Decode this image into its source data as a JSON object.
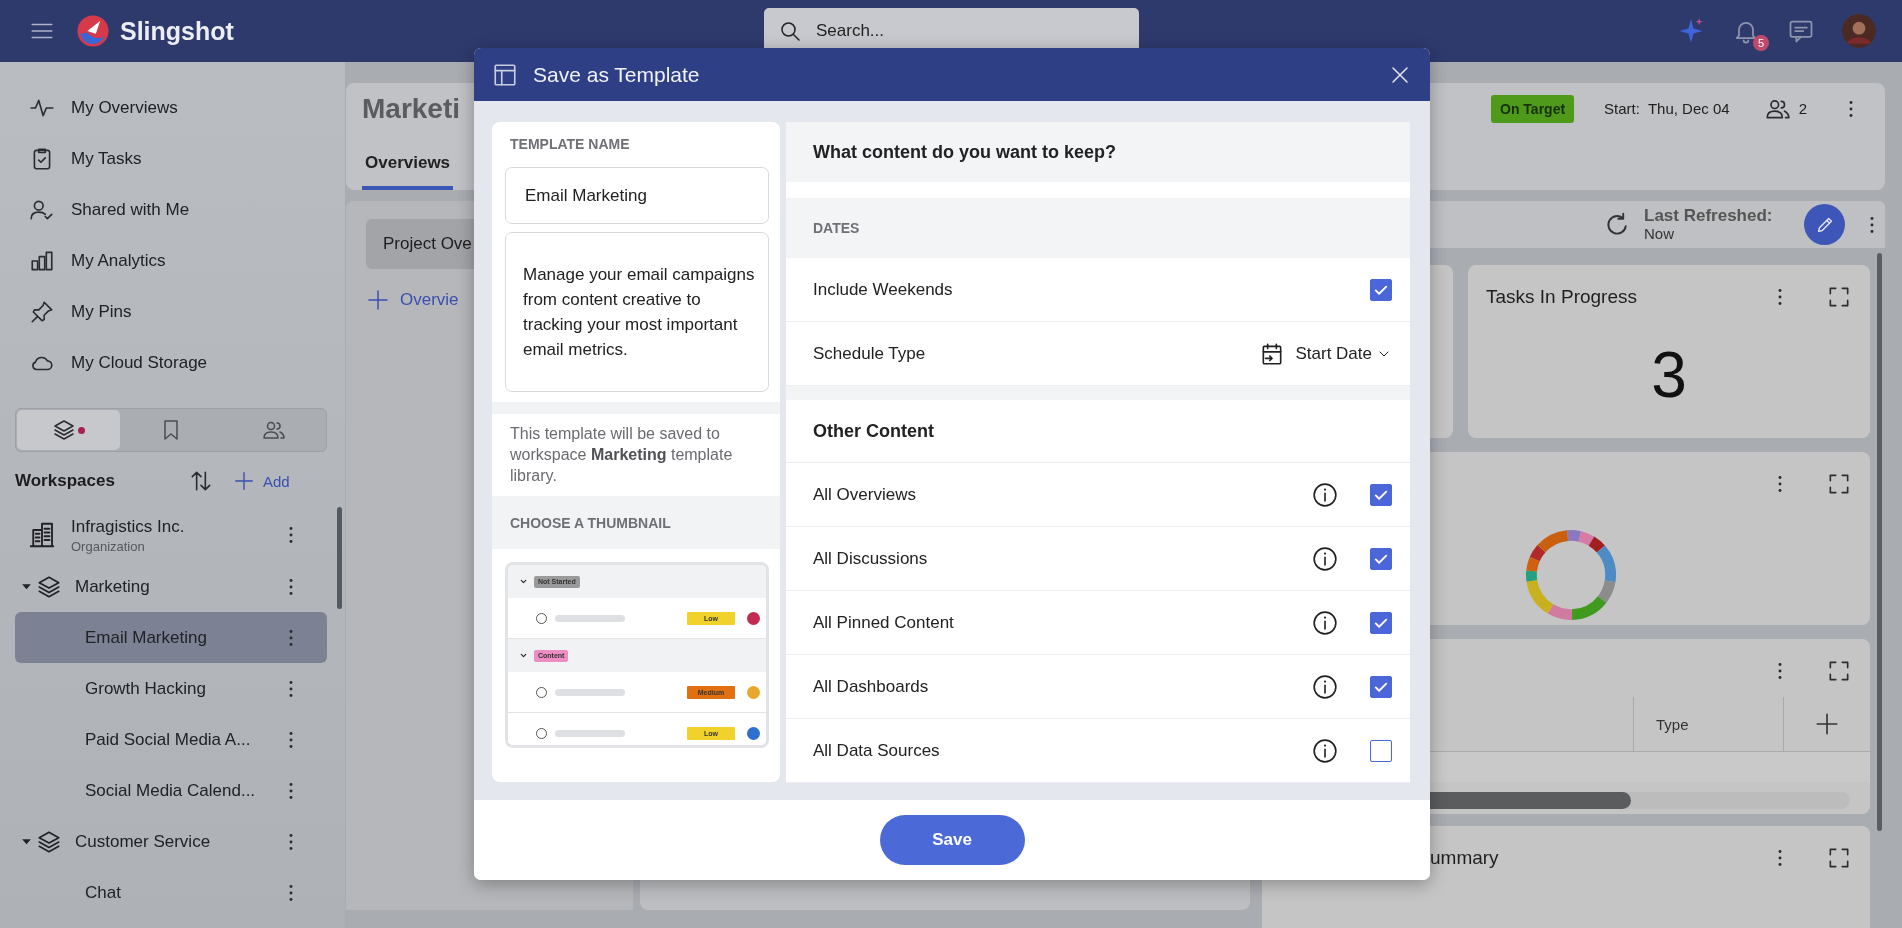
{
  "topbar": {
    "app_name": "Slingshot",
    "search": {
      "placeholder": "Search..."
    },
    "notifications": "5"
  },
  "sidebar": {
    "nav": [
      {
        "label": "My Overviews"
      },
      {
        "label": "My Tasks"
      },
      {
        "label": "Shared with Me"
      },
      {
        "label": "My Analytics"
      },
      {
        "label": "My Pins"
      },
      {
        "label": "My Cloud Storage"
      }
    ],
    "view_tabs": [
      {
        "selected": true,
        "dot": true
      },
      {
        "selected": false,
        "dot": false
      },
      {
        "selected": false,
        "dot": false
      }
    ],
    "workspaces": {
      "title": "Workspaces",
      "add": "Add"
    },
    "tree": [
      {
        "kind": "organization",
        "label": "Infragistics Inc.",
        "subtitle": "Organization"
      },
      {
        "kind": "workspace",
        "label": "Marketing",
        "expanded": true,
        "children": [
          {
            "label": "Email Marketing",
            "selected": true
          },
          {
            "label": "Growth Hacking",
            "selected": false
          },
          {
            "label": "Paid Social Media A...",
            "selected": false
          },
          {
            "label": "Social Media Calend...",
            "selected": false
          }
        ]
      },
      {
        "kind": "workspace",
        "label": "Customer Service",
        "expanded": true,
        "children": [
          {
            "label": "Chat",
            "selected": false
          }
        ]
      }
    ]
  },
  "project": {
    "title": "Marketi",
    "tabs": [
      {
        "label": "Overviews",
        "selected": true
      }
    ],
    "status": "On Target",
    "start_label": "Start:",
    "start_date": "Thu, Dec 04",
    "members": "2"
  },
  "overviews_panel": {
    "tab": "Project Ove",
    "add_link": "Overvie"
  },
  "dashboard": {
    "refresh_label": "Last Refreshed:",
    "refresh_time": "Now",
    "cards": [
      {
        "kind": "blank"
      },
      {
        "kind": "kpi",
        "title": "Tasks In Progress",
        "value": "3"
      },
      {
        "kind": "donut"
      },
      {
        "kind": "table",
        "columns": [
          "Type"
        ]
      },
      {
        "kind": "titled",
        "title": "ummary"
      }
    ]
  },
  "modal": {
    "title": "Save as Template",
    "name_label": "TEMPLATE NAME",
    "name_value": "Email Marketing",
    "description": "Manage your email campaigns from content creative to tracking your most important email metrics.",
    "note": "This template will be saved to workspace **Marketing** template library.",
    "thumbnail_label": "CHOOSE A THUMBNAIL",
    "thumbnail": [
      {
        "tag": "Not Started",
        "color": "#9a9a9a",
        "tasks": [
          {
            "priority": {
              "label": "Low",
              "color": "#f1d22a"
            },
            "avatar": {
              "color": "#c22a52"
            }
          }
        ]
      },
      {
        "tag": "Content",
        "color": "#ee8cc4",
        "tasks": [
          {
            "priority": {
              "label": "Medium",
              "color": "#e07010"
            },
            "avatar": {
              "color": "#e8a830"
            }
          },
          {
            "priority": {
              "label": "Low",
              "color": "#f1d22a"
            },
            "avatar": {
              "color": "#2e6fd0"
            }
          }
        ]
      }
    ],
    "question": "What content do you want to keep?",
    "sections": [
      {
        "kind": "caps",
        "title": "DATES",
        "rows": [
          {
            "kind": "checkbox",
            "label": "Include Weekends",
            "checked": true
          },
          {
            "kind": "select",
            "label": "Schedule Type",
            "value": "Start Date"
          }
        ]
      },
      {
        "kind": "heading",
        "title": "Other Content",
        "rows": [
          {
            "kind": "info-checkbox",
            "label": "All Overviews",
            "checked": true
          },
          {
            "kind": "info-checkbox",
            "label": "All Discussions",
            "checked": true
          },
          {
            "kind": "info-checkbox",
            "label": "All Pinned Content",
            "checked": true
          },
          {
            "kind": "info-checkbox",
            "label": "All Dashboards",
            "checked": true
          },
          {
            "kind": "info-checkbox",
            "label": "All Data Sources",
            "checked": false
          }
        ]
      }
    ],
    "save": "Save"
  }
}
